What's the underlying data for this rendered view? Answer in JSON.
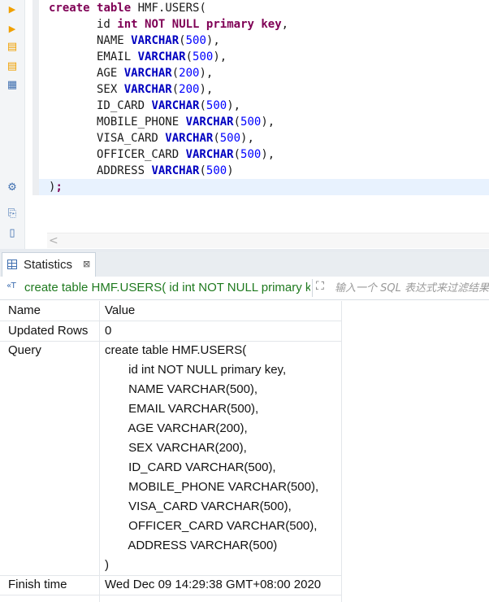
{
  "editor": {
    "code_lines": [
      [
        [
          "kw",
          "create"
        ],
        [
          "pn",
          " "
        ],
        [
          "kw",
          "table"
        ],
        [
          "pn",
          " HMF.USERS("
        ]
      ],
      [
        [
          "pn",
          "       id "
        ],
        [
          "kw",
          "int"
        ],
        [
          "pn",
          " "
        ],
        [
          "kw",
          "NOT"
        ],
        [
          "pn",
          " "
        ],
        [
          "kw",
          "NULL"
        ],
        [
          "pn",
          " "
        ],
        [
          "kw",
          "primary"
        ],
        [
          "pn",
          " "
        ],
        [
          "kw",
          "key"
        ],
        [
          "pn",
          ","
        ]
      ],
      [
        [
          "pn",
          "       NAME "
        ],
        [
          "ty",
          "VARCHAR"
        ],
        [
          "pn",
          "("
        ],
        [
          "nm",
          "500"
        ],
        [
          "pn",
          "),"
        ]
      ],
      [
        [
          "pn",
          "       EMAIL "
        ],
        [
          "ty",
          "VARCHAR"
        ],
        [
          "pn",
          "("
        ],
        [
          "nm",
          "500"
        ],
        [
          "pn",
          "),"
        ]
      ],
      [
        [
          "pn",
          "       AGE "
        ],
        [
          "ty",
          "VARCHAR"
        ],
        [
          "pn",
          "("
        ],
        [
          "nm",
          "200"
        ],
        [
          "pn",
          "),"
        ]
      ],
      [
        [
          "pn",
          "       SEX "
        ],
        [
          "ty",
          "VARCHAR"
        ],
        [
          "pn",
          "("
        ],
        [
          "nm",
          "200"
        ],
        [
          "pn",
          "),"
        ]
      ],
      [
        [
          "pn",
          "       ID_CARD "
        ],
        [
          "ty",
          "VARCHAR"
        ],
        [
          "pn",
          "("
        ],
        [
          "nm",
          "500"
        ],
        [
          "pn",
          "),"
        ]
      ],
      [
        [
          "pn",
          "       MOBILE_PHONE "
        ],
        [
          "ty",
          "VARCHAR"
        ],
        [
          "pn",
          "("
        ],
        [
          "nm",
          "500"
        ],
        [
          "pn",
          "),"
        ]
      ],
      [
        [
          "pn",
          "       VISA_CARD "
        ],
        [
          "ty",
          "VARCHAR"
        ],
        [
          "pn",
          "("
        ],
        [
          "nm",
          "500"
        ],
        [
          "pn",
          "),"
        ]
      ],
      [
        [
          "pn",
          "       OFFICER_CARD "
        ],
        [
          "ty",
          "VARCHAR"
        ],
        [
          "pn",
          "("
        ],
        [
          "nm",
          "500"
        ],
        [
          "pn",
          "),"
        ]
      ],
      [
        [
          "pn",
          "       ADDRESS "
        ],
        [
          "ty",
          "VARCHAR"
        ],
        [
          "pn",
          "("
        ],
        [
          "nm",
          "500"
        ],
        [
          "pn",
          ")"
        ]
      ],
      [
        [
          "pn",
          ")"
        ],
        [
          "kw",
          ";"
        ]
      ]
    ],
    "scroll_left_glyph": "<"
  },
  "toolbar_icons": [
    {
      "name": "execute-statement-icon",
      "glyph": "▶",
      "color": "#f0a000"
    },
    {
      "name": "execute-in-new-tab-icon",
      "glyph": "▶",
      "color": "#f0a000"
    },
    {
      "name": "execute-script-icon",
      "glyph": "▤",
      "color": "#f0a000"
    },
    {
      "name": "execute-script-new-tab-icon",
      "glyph": "▤",
      "color": "#f0a000"
    },
    {
      "name": "explain-plan-icon",
      "glyph": "▦",
      "color": "#3f6fb0"
    },
    {
      "name": "settings-icon",
      "glyph": "⚙",
      "color": "#3f6fb0"
    },
    {
      "name": "export-icon",
      "glyph": "⎘",
      "color": "#3f6fb0"
    },
    {
      "name": "load-file-icon",
      "glyph": "▯",
      "color": "#3f6fb0"
    }
  ],
  "panel": {
    "tab_label": "Statistics",
    "tab_close_glyph": "⊠",
    "query_icon_glyph": "«T",
    "query_text": "create table HMF.USERS( id int NOT NULL primary key,",
    "filter_icon_glyph": "⛶",
    "filter_placeholder": "输入一个 SQL 表达式来过滤结果"
  },
  "grid": {
    "headers": {
      "name": "Name",
      "value": "Value"
    },
    "rows": [
      {
        "name": "Updated Rows",
        "value": [
          "0"
        ]
      },
      {
        "name": "Query",
        "value": [
          "create table HMF.USERS(",
          "       id int NOT NULL primary key,",
          "       NAME VARCHAR(500),",
          "       EMAIL VARCHAR(500),",
          "       AGE VARCHAR(200),",
          "       SEX VARCHAR(200),",
          "       ID_CARD VARCHAR(500),",
          "       MOBILE_PHONE VARCHAR(500),",
          "       VISA_CARD VARCHAR(500),",
          "       OFFICER_CARD VARCHAR(500),",
          "       ADDRESS VARCHAR(500)",
          ")"
        ]
      },
      {
        "name": "Finish time",
        "value": [
          "Wed Dec 09 14:29:38 GMT+08:00 2020"
        ]
      }
    ]
  }
}
